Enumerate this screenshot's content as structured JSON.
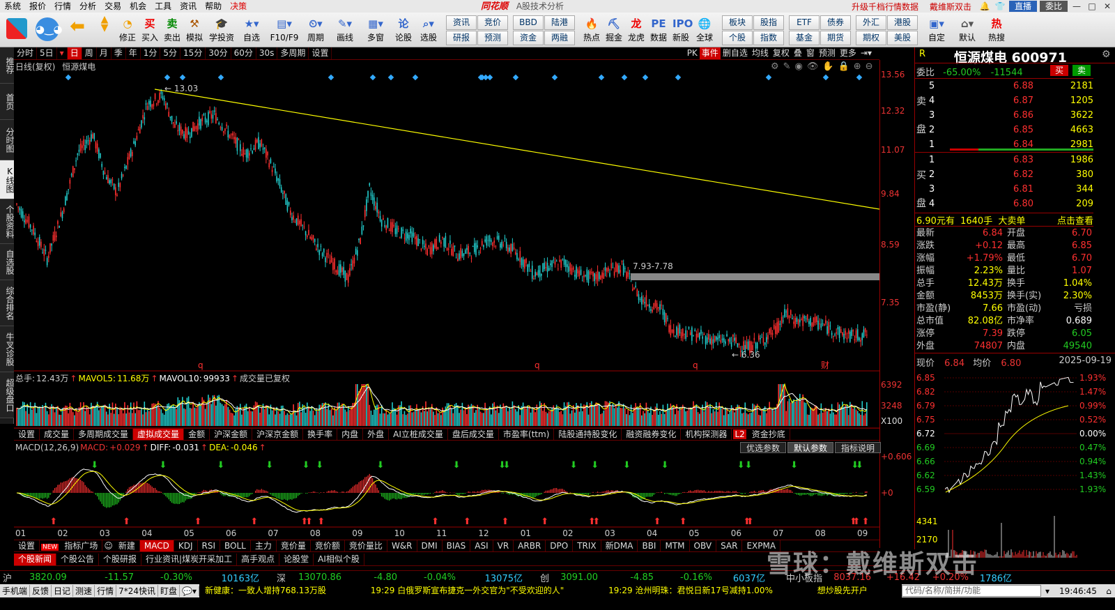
{
  "menu": {
    "items": [
      "系统",
      "报价",
      "行情",
      "分析",
      "交易",
      "机会",
      "工具",
      "资讯",
      "帮助",
      "决策"
    ],
    "logo": "同花顺",
    "subtitle": "A股技术分析",
    "upgrade": "升级千档行情数据",
    "user": "戴维斯双击",
    "live": "直播",
    "commission": "委比"
  },
  "toolbar": {
    "buttons": [
      "修正",
      "买入",
      "卖出",
      "模拟",
      "学投资",
      "自选",
      "F10/F9",
      "周期",
      "画线",
      "多窗",
      "论股",
      "选股"
    ],
    "grid1": [
      "资讯",
      "竞价",
      "研报",
      "预测"
    ],
    "grid2": [
      "BBD",
      "陆港",
      "资金",
      "两融"
    ],
    "buttons2": [
      "热点",
      "掘金",
      "龙虎",
      "数据",
      "新股",
      "全球"
    ],
    "grid3": [
      "板块",
      "股指",
      "个股",
      "指数"
    ],
    "grid4": [
      "ETF",
      "债券",
      "基金",
      "期货"
    ],
    "grid5": [
      "外汇",
      "港股",
      "期权",
      "美股"
    ],
    "buttons3": [
      "自定",
      "默认",
      "热搜"
    ]
  },
  "lefttabs": [
    "推荐",
    "首页",
    "分时图",
    "K线图",
    "个股资料",
    "自选股",
    "综合排名",
    "牛叉诊股",
    "超级盘口"
  ],
  "periods": [
    "分时",
    "5日",
    "日",
    "周",
    "月",
    "季",
    "年",
    "1分",
    "5分",
    "15分",
    "30分",
    "60分",
    "30s",
    "多周期",
    "设置"
  ],
  "period_right": [
    "PK",
    "事件",
    "删自选",
    "均线",
    "复权",
    "叠",
    "窗",
    "预测",
    "更多"
  ],
  "chart": {
    "title": "日线(复权)",
    "name": "恒源煤电",
    "high_label": "13.03",
    "gap_label": "7.93-7.78",
    "low_label": "6.36",
    "y_labels": [
      "13.56",
      "12.32",
      "11.07",
      "9.84",
      "8.59",
      "7.35"
    ],
    "marks": [
      "q",
      "q",
      "q",
      "财"
    ]
  },
  "vol": {
    "prefix": "总手:",
    "total": "12.43万",
    "mavol5_label": "MAVOL5:",
    "mavol5": "11.68万",
    "mavol10_label": "MAVOL10:",
    "mavol10": "99933",
    "note": "成交量已复权",
    "y_labels": [
      "6392",
      "3248",
      "X100"
    ]
  },
  "voltabs": [
    "设置",
    "成交量",
    "多周期成交量",
    "虚拟成交量",
    "金额",
    "沪深金额",
    "沪深京金额",
    "换手率",
    "内盘",
    "外盘",
    "AI立桩成交量",
    "盘后成交量",
    "市盈率(ttm)",
    "陆股通持股变化",
    "融资融券变化",
    "机构探测器",
    "资金抄底"
  ],
  "macd": {
    "name": "MACD(12,26,9)",
    "macd_label": "MACD:",
    "macd_val": "+0.029",
    "diff_label": "DIFF:",
    "diff_val": "-0.031",
    "dea_label": "DEA:",
    "dea_val": "-0.046",
    "y_labels": [
      "+0.606",
      "+0"
    ],
    "params": [
      "优选参数",
      "默认参数",
      "指标说明"
    ]
  },
  "months": [
    "01",
    "02",
    "03",
    "04",
    "05",
    "06",
    "07",
    "08",
    "09",
    "10",
    "11",
    "12",
    "01",
    "02",
    "03",
    "04",
    "05",
    "06",
    "07",
    "08",
    "09"
  ],
  "indtabs": [
    "设置",
    "指标广场",
    "新建",
    "MACD",
    "KDJ",
    "RSI",
    "BOLL",
    "主力",
    "竞价量",
    "竞价额",
    "竞价量比",
    "W&R",
    "DMI",
    "BIAS",
    "ASI",
    "VR",
    "ARBR",
    "DPO",
    "TRIX",
    "新DMA",
    "BBI",
    "MTM",
    "OBV",
    "SAR",
    "EXPMA"
  ],
  "newstabs": [
    "个股新闻",
    "个股公告",
    "个股研报",
    "行业资讯|煤炭开采加工",
    "高手观点",
    "论股堂",
    "AI相似个股"
  ],
  "quote": {
    "r": "R",
    "name": "恒源煤电",
    "code": "600971",
    "webi_label": "委比",
    "webi": "-65.00%",
    "webi_diff": "-11544",
    "buy": "买",
    "sell": "卖",
    "asks": [
      {
        "n": "5",
        "p": "6.88",
        "v": "2181"
      },
      {
        "n": "4",
        "p": "6.87",
        "v": "1205"
      },
      {
        "n": "3",
        "p": "6.86",
        "v": "3622"
      },
      {
        "n": "2",
        "p": "6.85",
        "v": "4663"
      },
      {
        "n": "1",
        "p": "6.84",
        "v": "2981"
      }
    ],
    "bids": [
      {
        "n": "1",
        "p": "6.83",
        "v": "1986"
      },
      {
        "n": "2",
        "p": "6.82",
        "v": "380"
      },
      {
        "n": "3",
        "p": "6.81",
        "v": "344"
      },
      {
        "n": "4",
        "p": "6.80",
        "v": "209"
      }
    ],
    "big_price": "6.90",
    "big_unit": "元有",
    "big_vol": "1640手",
    "big_label": "大卖单",
    "big_link": "点击查看",
    "stats": [
      [
        "最新",
        "6.84",
        "开盘",
        "6.70"
      ],
      [
        "涨跌",
        "+0.12",
        "最高",
        "6.85"
      ],
      [
        "涨幅",
        "+1.79%",
        "最低",
        "6.70"
      ],
      [
        "振幅",
        "2.23%",
        "量比",
        "1.07"
      ],
      [
        "总手",
        "12.43万",
        "换手",
        "1.04%"
      ],
      [
        "金额",
        "8453万",
        "换手(实)",
        "2.30%"
      ],
      [
        "市盈(静)",
        "7.66",
        "市盈(动)",
        "亏损"
      ],
      [
        "总市值",
        "82.08亿",
        "市净率",
        "0.689"
      ],
      [
        "涨停",
        "7.39",
        "跌停",
        "6.05"
      ],
      [
        "外盘",
        "74807",
        "内盘",
        "49540"
      ]
    ],
    "now_label": "现价",
    "now": "6.84",
    "avg_label": "均价",
    "avg": "6.80",
    "date": "2025-09-19",
    "mini_left": [
      "6.85",
      "6.82",
      "6.79",
      "6.75",
      "6.72",
      "6.69",
      "6.66",
      "6.62",
      "6.59"
    ],
    "mini_right": [
      "1.93%",
      "1.47%",
      "0.99%",
      "0.52%",
      "0.00%",
      "0.47%",
      "0.94%",
      "1.43%",
      "1.93%"
    ],
    "mini_vol": [
      "4341",
      "2170"
    ]
  },
  "indices": {
    "sh_label": "沪",
    "sh": "3820.09",
    "sh_chg": "-11.57",
    "sh_pct": "-0.30%",
    "sh_amt": "10163亿",
    "sz_label": "深",
    "sz": "13070.86",
    "sz_chg": "-4.80",
    "sz_pct": "-0.04%",
    "sz_amt": "13075亿",
    "cy_label": "创",
    "cy": "3091.00",
    "cy_chg": "-4.85",
    "cy_pct": "-0.16%",
    "cy_amt": "6037亿",
    "zx_label": "中小板指",
    "zx": "8037.16",
    "zx_chg": "+16.42",
    "zx_pct": "+0.20%",
    "zx_amt": "1786亿"
  },
  "status": {
    "items": [
      "手机端",
      "反馈",
      "日记",
      "测速",
      "行情",
      "7*24快讯",
      "盯盘"
    ],
    "news1": "新健康：一致人增持768.13万股",
    "news2": "19:29 白俄罗斯宣布捷克一外交官为\"不受欢迎的人\"",
    "news3": "19:29 沧州明珠：君悦日新17号减持1.00%",
    "news4": "想炒股先开户",
    "search": "代码/名称/简拼/功能",
    "time": "19:46:45"
  },
  "watermark": "雪球：戴维斯双击",
  "colors": {
    "up": "#ff3030",
    "down": "#22cccc",
    "yellow": "#ffff00",
    "accent": "#c00000"
  }
}
